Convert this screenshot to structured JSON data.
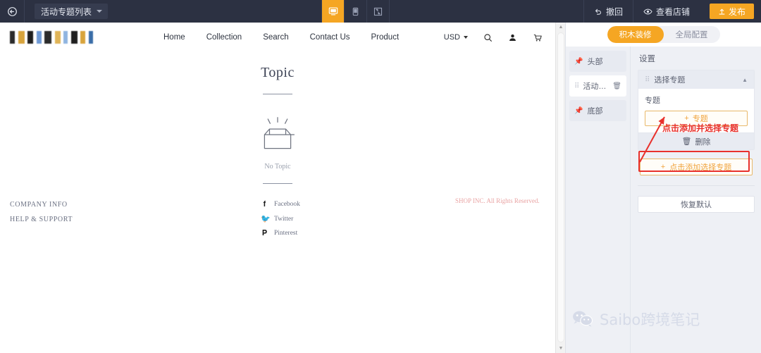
{
  "topbar": {
    "back_icon": "back-arrow-icon",
    "page_select": "活动专题列表",
    "device_desktop": "desktop-view-icon",
    "device_mobile": "mobile-view-icon",
    "device_fullscreen": "fullscreen-icon",
    "undo_label": "撤回",
    "preview_label": "查看店铺",
    "publish_label": "发布",
    "accent": "#f5a623",
    "background": "#2c3142"
  },
  "preview": {
    "logo_alt": "shop-logo",
    "menu": [
      "Home",
      "Collection",
      "Search",
      "Contact Us",
      "Product"
    ],
    "currency": "USD",
    "icons": [
      "search-icon",
      "account-icon",
      "cart-icon"
    ],
    "topic": {
      "title": "Topic",
      "empty_label": "No Topic"
    },
    "footer": {
      "links": [
        "COMPANY INFO",
        "HELP & SUPPORT"
      ],
      "social": [
        {
          "name": "Facebook",
          "glyph": "f"
        },
        {
          "name": "Twitter",
          "glyph": "t"
        },
        {
          "name": "Pinterest",
          "glyph": "p"
        }
      ],
      "copyright": "SHOP INC. All Rights Reserved.",
      "copyright_color": "#e9a3a3"
    }
  },
  "panel": {
    "tabs": [
      {
        "label": "积木装修",
        "active": true
      },
      {
        "label": "全局配置",
        "active": false
      }
    ],
    "modules": [
      {
        "label": "头部",
        "icon": "pin-icon",
        "selected": false,
        "deletable": false
      },
      {
        "label": "活动专...",
        "icon": "drag-handle-icon",
        "selected": true,
        "deletable": true
      },
      {
        "label": "底部",
        "icon": "pin-icon",
        "selected": false,
        "deletable": false
      }
    ],
    "settings_title": "设置",
    "card": {
      "header": "选择专题",
      "collapse_icon": "chevron-up-icon",
      "field_label": "专题",
      "add_label": "专题",
      "delete_label": "删除"
    },
    "add_outer_label": "点击添加选择专题",
    "restore_label": "恢复默认"
  },
  "annotation": {
    "text": "点击添加并选择专题",
    "color": "#e8312c"
  },
  "watermark": {
    "icon": "wechat-icon",
    "text": "Saibo跨境笔记"
  }
}
